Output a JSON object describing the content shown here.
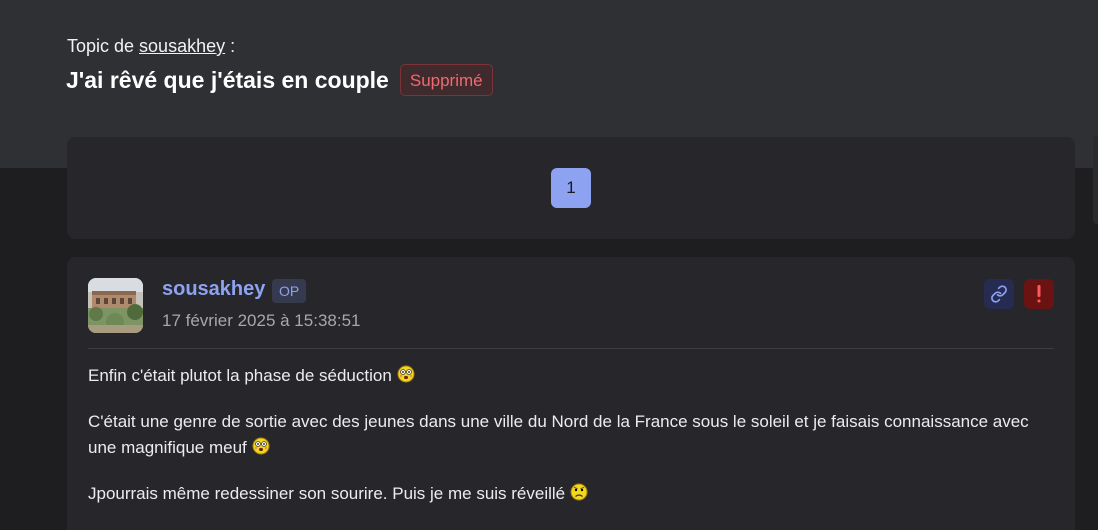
{
  "header": {
    "topic_by_prefix": "Topic de ",
    "author_link": "sousakhey",
    "topic_by_suffix": " :",
    "title": "J'ai rêvé que j'étais en couple",
    "status_badge": "Supprimé"
  },
  "pagination": {
    "current_page": "1"
  },
  "post": {
    "author": "sousakhey",
    "author_badge": "OP",
    "date": "17 février 2025 à 15:38:51",
    "link_icon": "link-icon",
    "report_icon": "exclamation-icon",
    "paragraphs": [
      {
        "text": "Enfin c'était plutot la phase de séduction",
        "smiley": "blushing-smiley-icon"
      },
      {
        "text": "C'était une genre de sortie avec des jeunes dans une ville du Nord de la France sous le soleil et je faisais connaissance avec une magnifique meuf",
        "smiley": "blushing-smiley-icon"
      },
      {
        "text": "Jpourrais même redessiner son sourire. Puis je me suis réveillé",
        "smiley": "sad-smiley-icon"
      }
    ]
  },
  "colors": {
    "accent": "#8ea2f2",
    "deleted_red": "#f06a6f",
    "report_red": "#6b1313",
    "card_bg": "#27272b",
    "header_bg": "#2f3034",
    "page_bg": "#1e1e21"
  }
}
